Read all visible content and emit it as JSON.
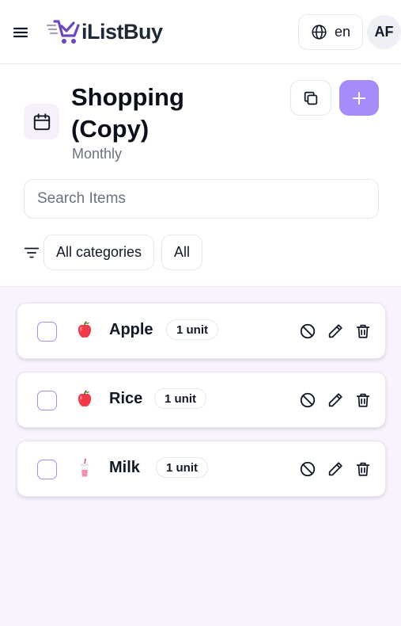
{
  "header": {
    "app_name": "iListBuy",
    "language": "en",
    "avatar_initials": "AF"
  },
  "list": {
    "title": "Shopping (Copy)",
    "subtitle": "Monthly"
  },
  "search": {
    "placeholder": "Search Items",
    "value": ""
  },
  "filters": {
    "category_chip": "All categories",
    "status_chip": "All"
  },
  "items": [
    {
      "name": "Apple",
      "unit": "1 unit",
      "icon": "apple-icon"
    },
    {
      "name": "Rice",
      "unit": "1 unit",
      "icon": "apple-icon"
    },
    {
      "name": "Milk",
      "unit": "1 unit",
      "icon": "milk-cup-icon"
    }
  ],
  "colors": {
    "accent": "#a78bfa",
    "items_background": "#f8f3fe",
    "title_icon_background": "#f6f0fb"
  }
}
